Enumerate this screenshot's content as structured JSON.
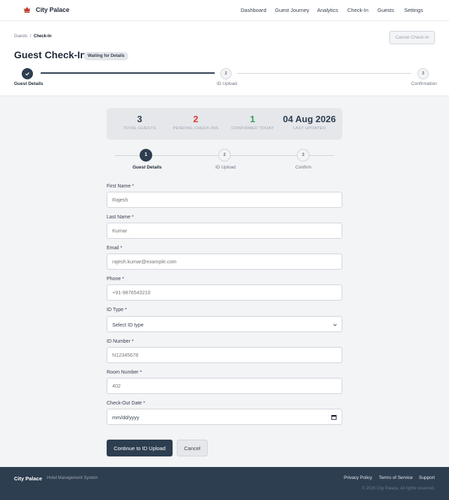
{
  "app": {
    "name": "City Palace"
  },
  "nav": {
    "items": [
      "Dashboard",
      "Guest Journey",
      "Analytics",
      "Check-In",
      "Guests",
      "Settings"
    ]
  },
  "breadcrumb": {
    "parent": "Guests",
    "separator": "/",
    "current": "Check-In"
  },
  "header": {
    "title": "Guest Check-In",
    "status": "Waiting for Details",
    "cancel_label": "Cancel Check-In"
  },
  "main_progress": {
    "steps": [
      {
        "number": "1",
        "label": "Guest Details",
        "state": "complete"
      },
      {
        "number": "2",
        "label": "ID Upload",
        "state": "pending"
      },
      {
        "number": "3",
        "label": "Confirmation",
        "state": "pending"
      }
    ]
  },
  "stats": [
    {
      "value": "3",
      "label": "TOTAL GUESTS",
      "color": "#2d3e50"
    },
    {
      "value": "2",
      "label": "PENDING CHECK-INS",
      "color": "#dc3c2f"
    },
    {
      "value": "1",
      "label": "CONFIRMED TODAY",
      "color": "#2f9e5a"
    },
    {
      "value": "04 Aug 2026",
      "label": "LAST UPDATED",
      "color": "#2d3e50"
    }
  ],
  "form_progress": {
    "steps": [
      {
        "number": "1",
        "label": "Guest Details",
        "state": "active"
      },
      {
        "number": "2",
        "label": "ID Upload",
        "state": "pending"
      },
      {
        "number": "3",
        "label": "Confirm",
        "state": "pending"
      }
    ]
  },
  "form": {
    "first_name": {
      "label": "First Name *",
      "placeholder": "Rajesh"
    },
    "last_name": {
      "label": "Last Name *",
      "placeholder": "Kumar"
    },
    "email": {
      "label": "Email *",
      "placeholder": "rajesh.kumar@example.com"
    },
    "phone": {
      "label": "Phone *",
      "placeholder": "+91-9876543210"
    },
    "id_type": {
      "label": "ID Type *",
      "value": "Select ID type"
    },
    "id_number": {
      "label": "ID Number *",
      "placeholder": "N12345678"
    },
    "room_number": {
      "label": "Room Number *",
      "placeholder": "402"
    },
    "checkout_date": {
      "label": "Check-Out Date *",
      "value": "mm/dd/yyyy"
    },
    "submit_label": "Continue to ID Upload",
    "cancel_label": "Cancel"
  },
  "footer": {
    "brand": "City Palace",
    "subtitle": "Hotel Management System",
    "links": [
      "Privacy Policy",
      "Terms of Service",
      "Support"
    ],
    "copyright": "© 2026 City Palace. All rights reserved."
  },
  "colors": {
    "primary": "#2d3e50",
    "pending": "#dc3c2f",
    "confirmed": "#2f9e5a",
    "logo": "#c0392b"
  }
}
